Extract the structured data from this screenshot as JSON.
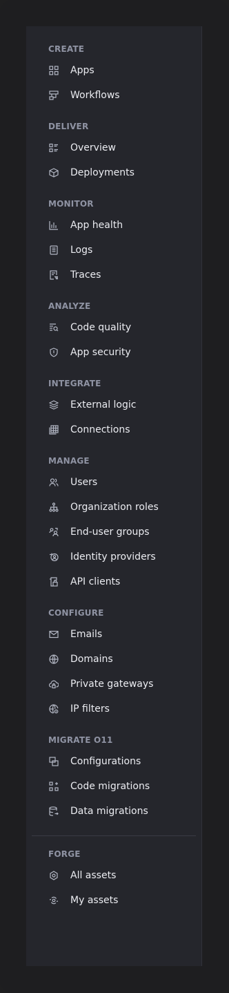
{
  "sidebar": {
    "sections": [
      {
        "title": "CREATE",
        "items": [
          {
            "label": "Apps",
            "icon": "apps-icon"
          },
          {
            "label": "Workflows",
            "icon": "workflows-icon"
          }
        ]
      },
      {
        "title": "DELIVER",
        "items": [
          {
            "label": "Overview",
            "icon": "overview-icon"
          },
          {
            "label": "Deployments",
            "icon": "box-icon"
          }
        ]
      },
      {
        "title": "MONITOR",
        "items": [
          {
            "label": "App health",
            "icon": "bar-chart-icon"
          },
          {
            "label": "Logs",
            "icon": "document-icon"
          },
          {
            "label": "Traces",
            "icon": "trace-icon"
          }
        ]
      },
      {
        "title": "ANALYZE",
        "items": [
          {
            "label": "Code quality",
            "icon": "search-list-icon"
          },
          {
            "label": "App security",
            "icon": "shield-icon"
          }
        ]
      },
      {
        "title": "INTEGRATE",
        "items": [
          {
            "label": "External logic",
            "icon": "layers-icon"
          },
          {
            "label": "Connections",
            "icon": "table-icon"
          }
        ]
      },
      {
        "title": "MANAGE",
        "items": [
          {
            "label": "Users",
            "icon": "users-icon"
          },
          {
            "label": "Organization roles",
            "icon": "org-chart-icon"
          },
          {
            "label": "End-user groups",
            "icon": "user-group-icon"
          },
          {
            "label": "Identity providers",
            "icon": "identity-icon"
          },
          {
            "label": "API clients",
            "icon": "api-client-icon"
          }
        ]
      },
      {
        "title": "CONFIGURE",
        "items": [
          {
            "label": "Emails",
            "icon": "mail-icon"
          },
          {
            "label": "Domains",
            "icon": "globe-icon"
          },
          {
            "label": "Private gateways",
            "icon": "cloud-lock-icon"
          },
          {
            "label": "IP filters",
            "icon": "globe-filter-icon"
          }
        ]
      },
      {
        "title": "MIGRATE O11",
        "items": [
          {
            "label": "Configurations",
            "icon": "config-icon"
          },
          {
            "label": "Code migrations",
            "icon": "code-migration-icon"
          },
          {
            "label": "Data migrations",
            "icon": "database-icon"
          }
        ]
      },
      {
        "title": "FORGE",
        "items": [
          {
            "label": "All assets",
            "icon": "forge-icon"
          },
          {
            "label": "My assets",
            "icon": "my-assets-icon"
          }
        ]
      }
    ]
  }
}
